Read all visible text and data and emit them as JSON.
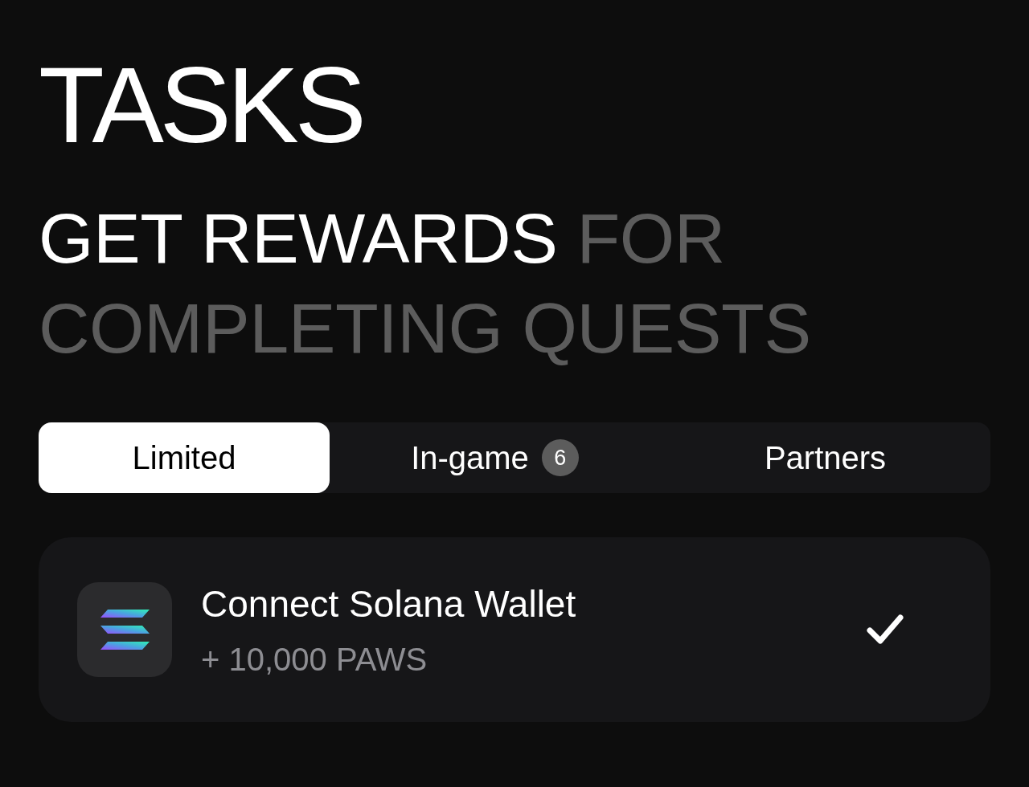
{
  "header": {
    "title": "TASKS",
    "subtitle": [
      {
        "text": "GET REWARDS",
        "emphasis": true
      },
      {
        "text": "FOR COMPLETING QUESTS",
        "emphasis": false
      }
    ]
  },
  "tabs": [
    {
      "label": "Limited",
      "selected": true
    },
    {
      "label": "In-game",
      "selected": false,
      "badge": "6"
    },
    {
      "label": "Partners",
      "selected": false
    }
  ],
  "tasks": [
    {
      "title": "Connect Solana Wallet",
      "reward": "+ 10,000 PAWS",
      "completed": true
    }
  ]
}
